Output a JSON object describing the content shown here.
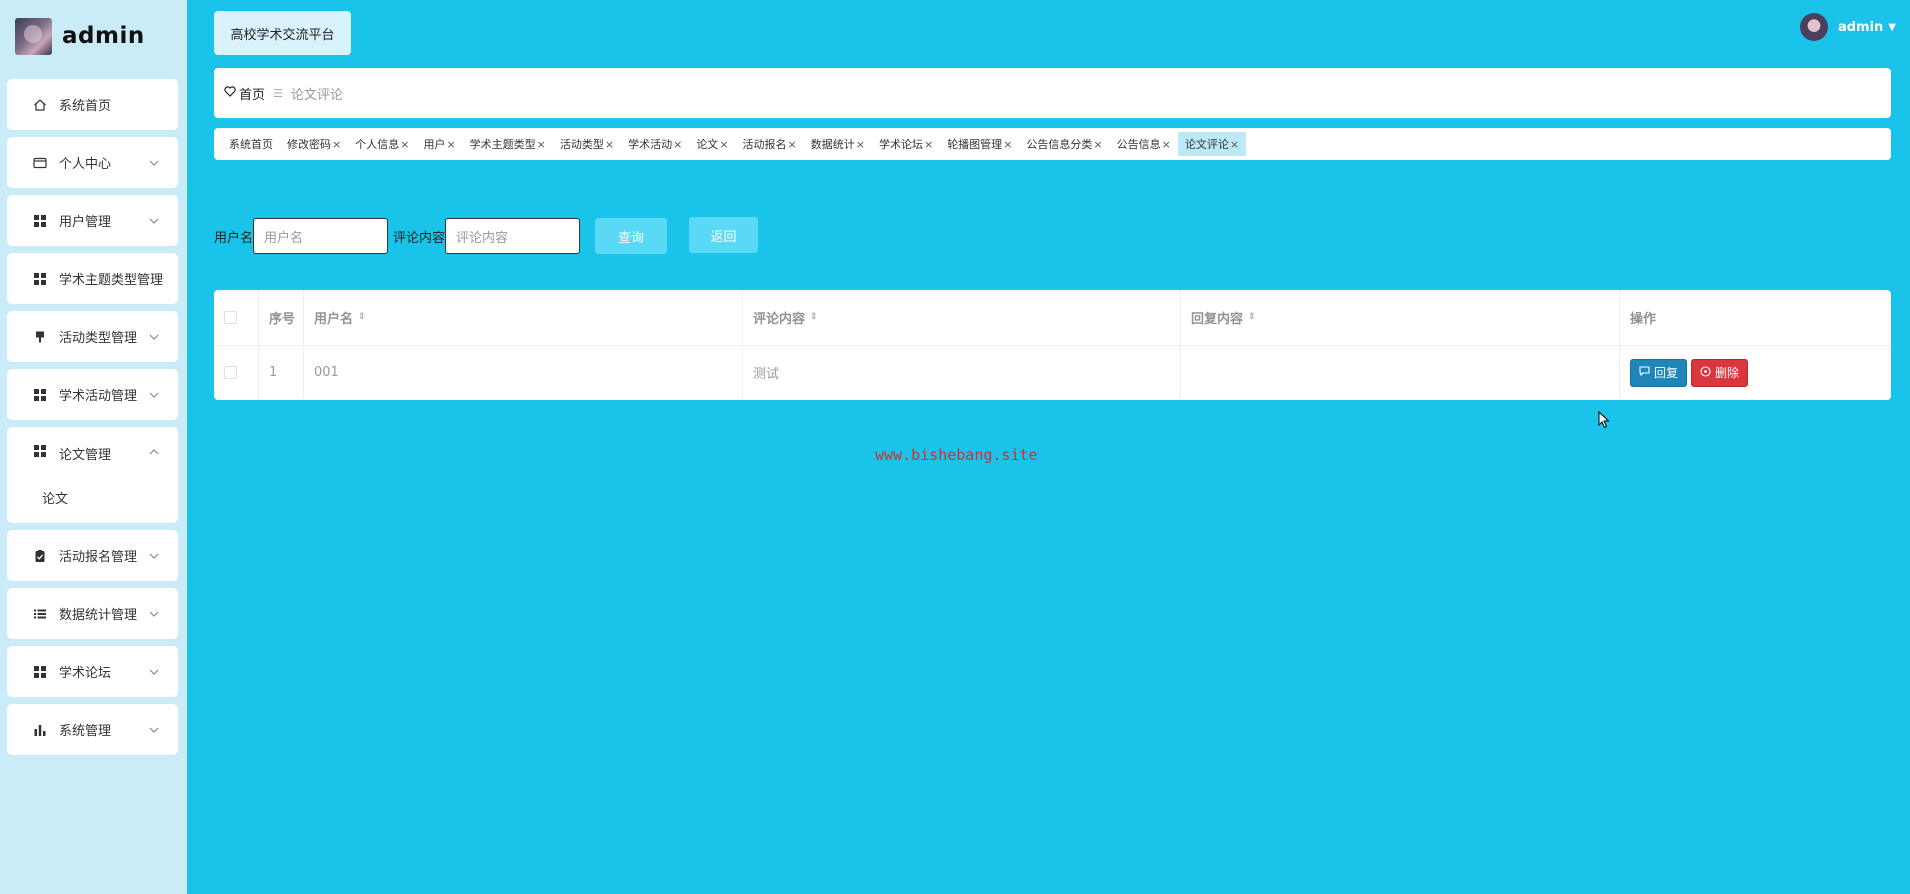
{
  "brand": {
    "title": "admin"
  },
  "sidebar": {
    "items": [
      {
        "label": "系统首页",
        "icon": "home-icon",
        "has_arrow": false
      },
      {
        "label": "个人中心",
        "icon": "id-card-icon",
        "has_arrow": true
      },
      {
        "label": "用户管理",
        "icon": "grid-icon",
        "has_arrow": true
      },
      {
        "label": "学术主题类型管理",
        "icon": "grid-icon",
        "has_arrow": false
      },
      {
        "label": "活动类型管理",
        "icon": "brush-icon",
        "has_arrow": true
      },
      {
        "label": "学术活动管理",
        "icon": "grid-icon",
        "has_arrow": true
      },
      {
        "label": "论文管理",
        "icon": "grid-icon",
        "has_arrow": true,
        "open": true,
        "sub": [
          "论文"
        ]
      },
      {
        "label": "活动报名管理",
        "icon": "clipboard-icon",
        "has_arrow": true
      },
      {
        "label": "数据统计管理",
        "icon": "list-icon",
        "has_arrow": true
      },
      {
        "label": "学术论坛",
        "icon": "grid-icon",
        "has_arrow": true
      },
      {
        "label": "系统管理",
        "icon": "bar-chart-icon",
        "has_arrow": true
      }
    ]
  },
  "header": {
    "platform_label": "高校学术交流平台",
    "user_name": "admin"
  },
  "breadcrumb": {
    "home": "首页",
    "current": "论文评论"
  },
  "tabs": [
    {
      "label": "系统首页",
      "closable": false
    },
    {
      "label": "修改密码",
      "closable": true
    },
    {
      "label": "个人信息",
      "closable": true
    },
    {
      "label": "用户",
      "closable": true
    },
    {
      "label": "学术主题类型",
      "closable": true
    },
    {
      "label": "活动类型",
      "closable": true
    },
    {
      "label": "学术活动",
      "closable": true
    },
    {
      "label": "论文",
      "closable": true
    },
    {
      "label": "活动报名",
      "closable": true
    },
    {
      "label": "数据统计",
      "closable": true
    },
    {
      "label": "学术论坛",
      "closable": true
    },
    {
      "label": "轮播图管理",
      "closable": true
    },
    {
      "label": "公告信息分类",
      "closable": true
    },
    {
      "label": "公告信息",
      "closable": true
    },
    {
      "label": "论文评论",
      "closable": true,
      "active": true
    }
  ],
  "search": {
    "username_label": "用户名",
    "username_placeholder": "用户名",
    "comment_label": "评论内容",
    "comment_placeholder": "评论内容",
    "query_button": "查询",
    "back_button": "返回"
  },
  "table": {
    "columns": [
      "序号",
      "用户名",
      "评论内容",
      "回复内容",
      "操作"
    ],
    "rows": [
      {
        "index": "1",
        "username": "001",
        "comment": "测试",
        "reply": ""
      }
    ],
    "reply_button": "回复",
    "delete_button": "删除"
  },
  "watermark": "www.bishebang.site",
  "colors": {
    "page_bg": "#19c3ea",
    "sidebar_bg": "#c9ecf8",
    "reply_btn": "#1f86b8",
    "delete_btn": "#d9363e",
    "search_btn": "#5ad9f6",
    "watermark": "#d0302f"
  }
}
